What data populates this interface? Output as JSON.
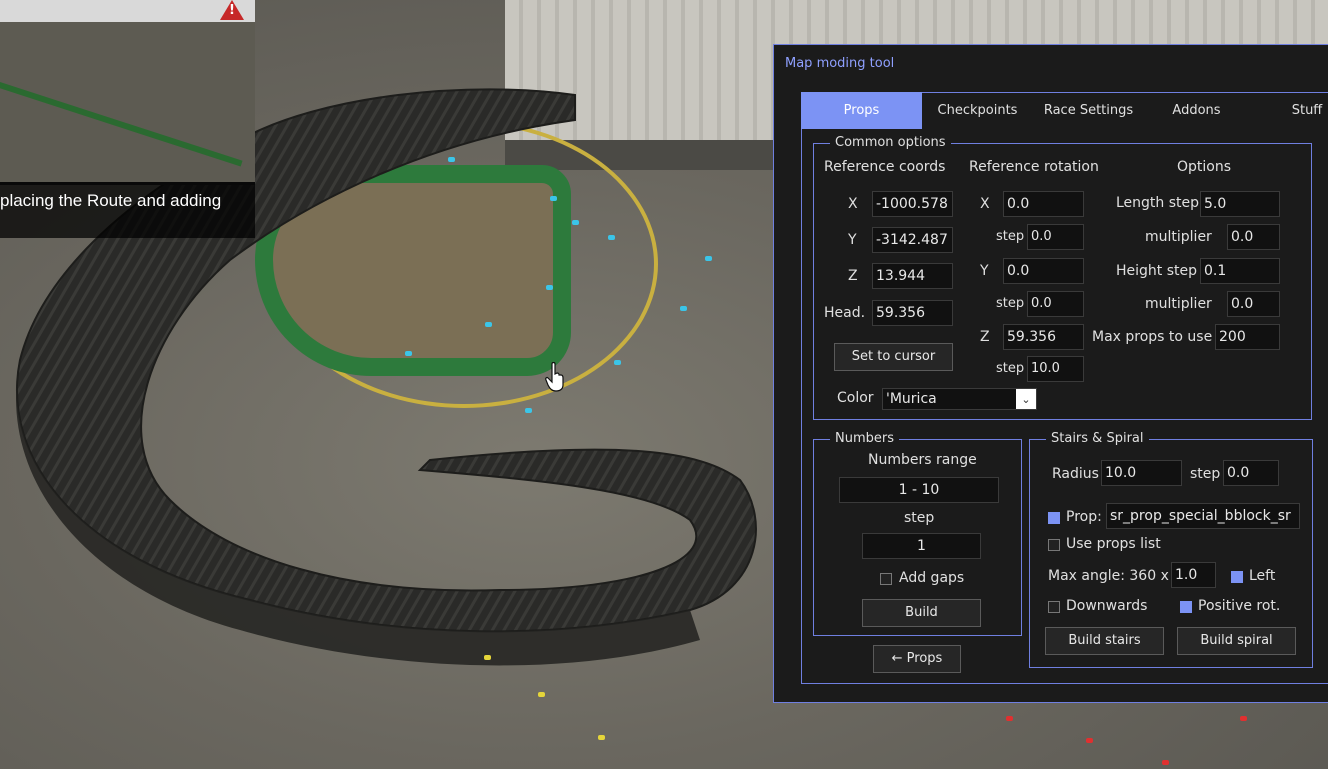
{
  "hud": {
    "hint_text": "placing the Route and adding"
  },
  "window": {
    "title": "Map moding tool",
    "tabs": [
      "Props",
      "Checkpoints",
      "Race Settings",
      "Addons",
      "Stuff"
    ],
    "active_tab": "Props"
  },
  "common": {
    "legend": "Common options",
    "ref_coords_label": "Reference coords",
    "ref_rotation_label": "Reference rotation",
    "options_label": "Options",
    "x_label": "X",
    "y_label": "Y",
    "z_label": "Z",
    "head_label": "Head.",
    "coord_x": "-1000.578",
    "coord_y": "-3142.487",
    "coord_z": "13.944",
    "heading": "59.356",
    "set_cursor_button": "Set to cursor",
    "color_label": "Color",
    "color_value": "'Murica",
    "rot_x": "0.0",
    "rot_x_step": "0.0",
    "rot_y": "0.0",
    "rot_y_step": "0.0",
    "rot_z": "59.356",
    "rot_z_step": "10.0",
    "step_label": "step",
    "length_step_label": "Length step",
    "length_step": "5.0",
    "multiplier_label": "multiplier",
    "length_multiplier": "0.0",
    "height_step_label": "Height step",
    "height_step": "0.1",
    "height_multiplier": "0.0",
    "max_props_label": "Max props to use",
    "max_props": "200"
  },
  "numbers": {
    "legend": "Numbers",
    "range_label": "Numbers range",
    "range_value": "1  -  10",
    "step_label": "step",
    "step_value": "1",
    "add_gaps_label": "Add gaps",
    "add_gaps_checked": false,
    "build_button": "Build"
  },
  "stairs": {
    "legend": "Stairs & Spiral",
    "radius_label": "Radius",
    "radius": "10.0",
    "step_label": "step",
    "step": "0.0",
    "prop_label": "Prop:",
    "prop_checked": true,
    "prop_value": "sr_prop_special_bblock_sr",
    "use_props_list_label": "Use props list",
    "use_props_list_checked": false,
    "max_angle_label": "Max angle: 360 x",
    "max_angle": "1.0",
    "left_label": "Left",
    "left_checked": true,
    "downwards_label": "Downwards",
    "downwards_checked": false,
    "positive_rot_label": "Positive rot.",
    "positive_rot_checked": true,
    "build_stairs_button": "Build stairs",
    "build_spiral_button": "Build spiral"
  },
  "nav": {
    "props_back_button": "← Props"
  },
  "colors": {
    "accent": "#7c93f4",
    "border": "#6f7fe0",
    "panel_bg": "#1b1b1b",
    "title": "#8fa0ff"
  }
}
